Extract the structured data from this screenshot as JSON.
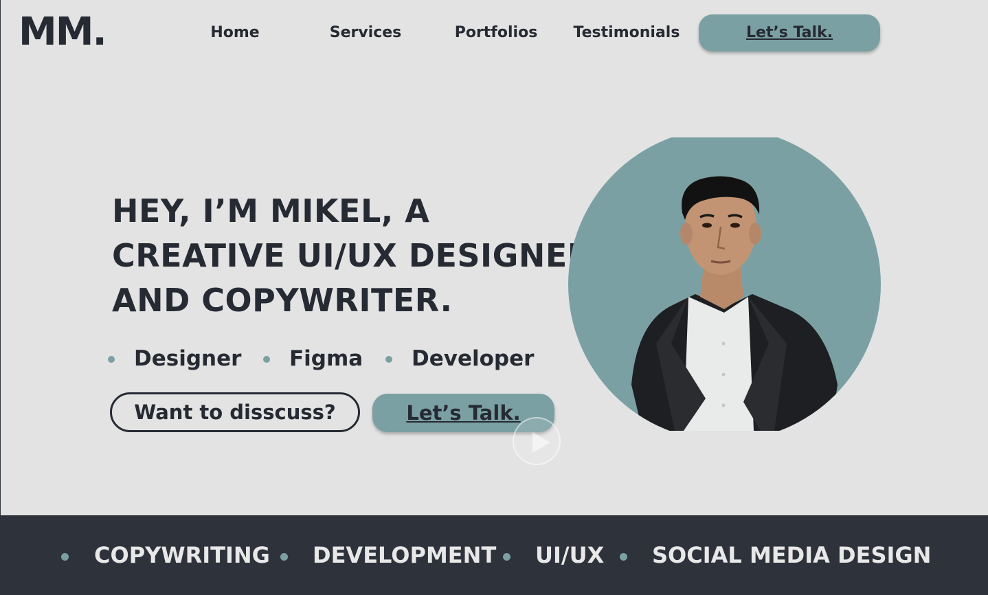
{
  "header": {
    "logo": "MM.",
    "nav": [
      "Home",
      "Services",
      "Portfolios",
      "Testimonials"
    ],
    "cta_label": "Let’s Talk."
  },
  "hero": {
    "line1": "HEY, I’M MIKEL, A",
    "line2_pre": "CREATIVE ",
    "line2_highlight": "UI/UX",
    "line2_post": " DESIGNER",
    "line3": "AND COPYWRITER.",
    "skills": [
      "Designer",
      "Figma",
      "Developer"
    ],
    "secondary_button": "Want to disscuss?",
    "primary_button": "Let’s Talk."
  },
  "services_band": [
    "COPYWRITING",
    "DEVELOPMENT",
    "UI/UX",
    "SOCIAL MEDIA DESIGN"
  ],
  "colors": {
    "background": "#e3e3e3",
    "accent": "#7ba0a3",
    "dark": "#2e323b",
    "text": "#262a33"
  },
  "icons": [
    "play-icon"
  ]
}
